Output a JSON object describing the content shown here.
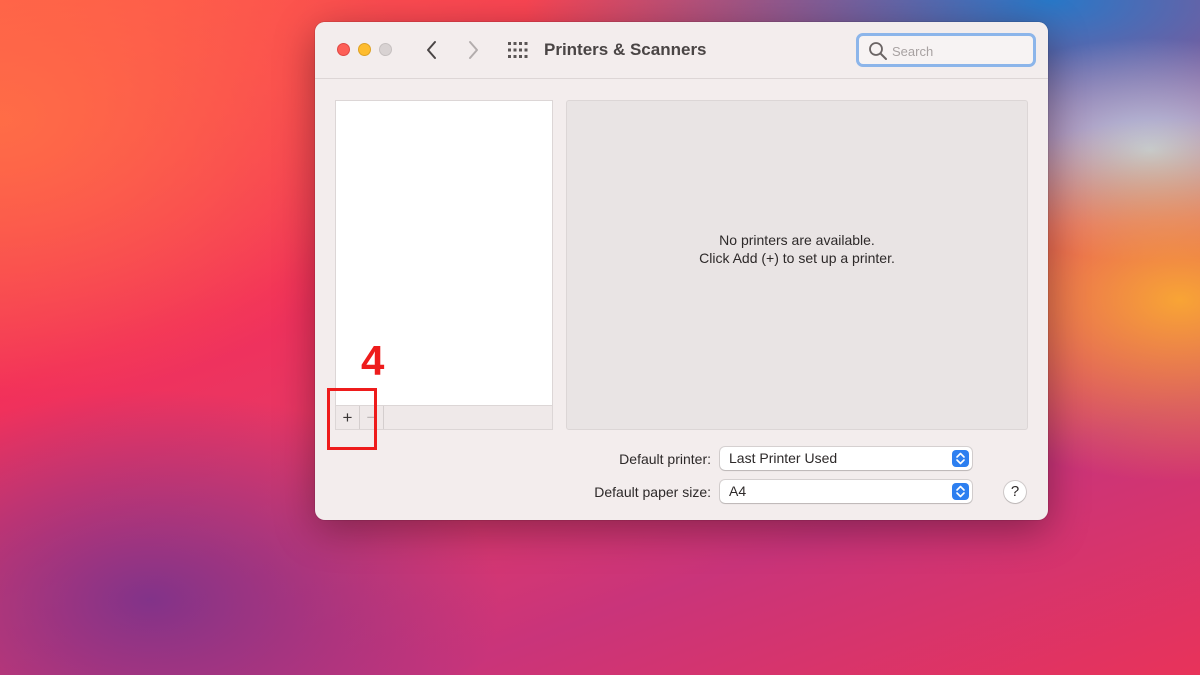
{
  "window": {
    "title": "Printers & Scanners",
    "traffic_lights": [
      "close",
      "minimize",
      "zoom"
    ]
  },
  "toolbar": {
    "back_icon": "chevron-left-icon",
    "forward_icon": "chevron-right-icon",
    "grid_icon": "show-all-grid-icon"
  },
  "search": {
    "placeholder": "Search",
    "value": "",
    "icon": "magnifying-glass-icon"
  },
  "printer_list": {
    "items": [],
    "add_label": "+",
    "remove_label": "−"
  },
  "detail": {
    "empty_line1": "No printers are available.",
    "empty_line2": "Click Add (+) to set up a printer."
  },
  "settings": {
    "default_printer_label": "Default printer:",
    "default_printer_value": "Last Printer Used",
    "default_paper_label": "Default paper size:",
    "default_paper_value": "A4",
    "help_label": "?"
  },
  "annotation": {
    "step_number": "4",
    "color": "#ee1c1c"
  },
  "colors": {
    "accent": "#2d7ff0",
    "search_focus": "#8cb5ea",
    "close": "#fd5f57",
    "minimize": "#febc2e",
    "zoom_disabled": "#d8d2d2"
  }
}
